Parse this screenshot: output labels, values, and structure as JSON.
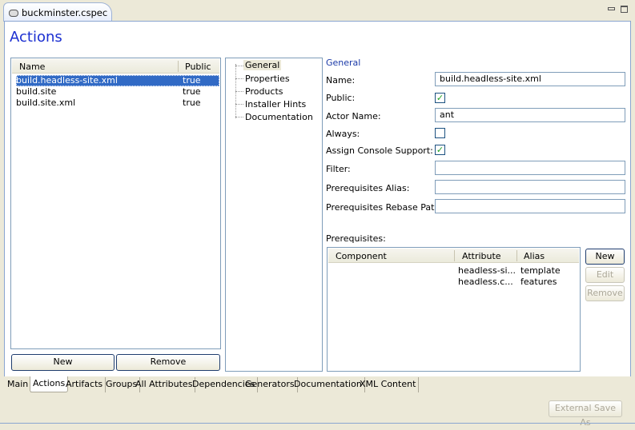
{
  "editor_tab": {
    "title": "buckminster.cspec",
    "icon": "cspec-icon",
    "close": "close-icon"
  },
  "window_controls": {
    "minimize": "minimize-icon",
    "maximize": "maximize-icon"
  },
  "page_title": "Actions",
  "actions_table": {
    "columns": [
      "Name",
      "Public"
    ],
    "rows": [
      [
        "build.headless-site.xml",
        "true"
      ],
      [
        "build.site",
        "true"
      ],
      [
        "build.site.xml",
        "true"
      ]
    ],
    "selected": 0
  },
  "actions_buttons": {
    "new": "New",
    "remove": "Remove"
  },
  "tree": {
    "items": [
      "General",
      "Properties",
      "Products",
      "Installer Hints",
      "Documentation"
    ],
    "selected": 0
  },
  "form": {
    "section": "General",
    "name_label": "Name:",
    "name_value": "build.headless-site.xml",
    "public_label": "Public:",
    "public_checked": true,
    "actor_label": "Actor Name:",
    "actor_value": "ant",
    "always_label": "Always:",
    "always_checked": false,
    "console_label": "Assign Console Support:",
    "console_checked": true,
    "filter_label": "Filter:",
    "filter_value": "",
    "alias_label": "Prerequisites Alias:",
    "alias_value": "",
    "rebase_label": "Prerequisites Rebase Path:",
    "rebase_value": "",
    "prereq_label": "Prerequisites:",
    "check_mark": "✓"
  },
  "prereq_table": {
    "columns": [
      "Component",
      "Attribute",
      "Alias"
    ],
    "rows": [
      [
        "",
        "headless-si...",
        "template"
      ],
      [
        "",
        "headless.c...",
        "features"
      ]
    ]
  },
  "prereq_buttons": {
    "new": "New",
    "edit": "Edit",
    "remove": "Remove"
  },
  "bottom_tabs": [
    "Main",
    "Actions",
    "Artifacts",
    "Groups",
    "All Attributes",
    "Dependencies",
    "Generators",
    "Documentation",
    "XML Content"
  ],
  "active_bottom_tab": "Actions",
  "external_save": "External Save As"
}
